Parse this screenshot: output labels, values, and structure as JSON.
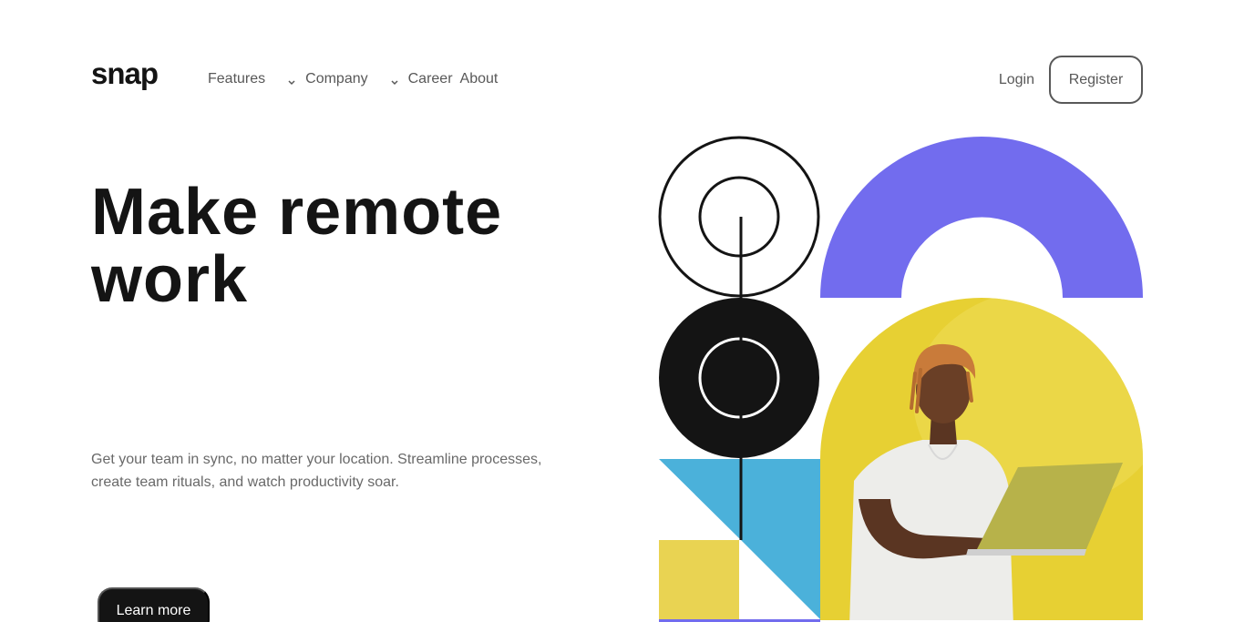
{
  "header": {
    "logo": "snap",
    "nav": [
      {
        "label": "Features",
        "has_dropdown": true
      },
      {
        "label": "Company",
        "has_dropdown": true
      },
      {
        "label": "Career",
        "has_dropdown": false
      },
      {
        "label": "About",
        "has_dropdown": false
      }
    ],
    "login_label": "Login",
    "register_label": "Register"
  },
  "hero": {
    "headline_line1": "Make remote",
    "headline_line2": "work",
    "description": "Get your team in sync, no matter your location. Streamline processes, create team rituals, and watch productivity soar.",
    "cta_label": "Learn more"
  },
  "colors": {
    "ink": "#141414",
    "muted": "#696969",
    "purple": "#726CEE",
    "yellow": "#E7D033",
    "blue": "#4BB1DA",
    "tile_yellow": "#E9D352"
  }
}
